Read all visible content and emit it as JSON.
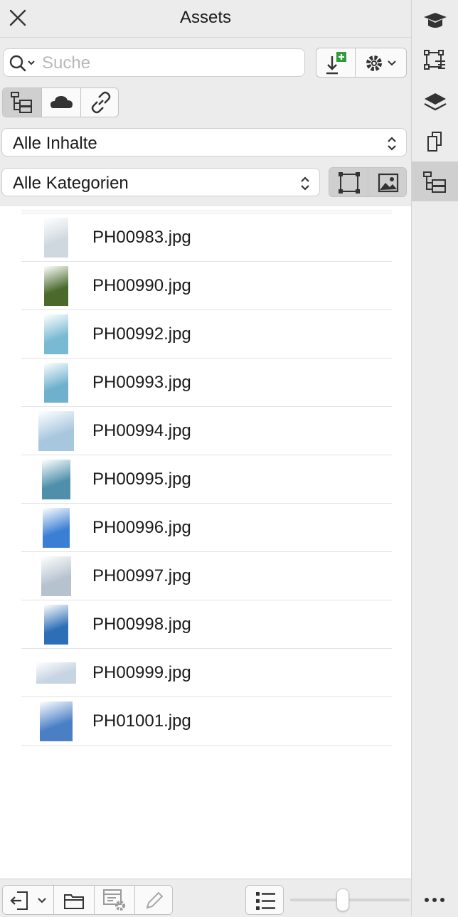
{
  "header": {
    "title": "Assets"
  },
  "search": {
    "placeholder": "Suche"
  },
  "filters": {
    "content_label": "Alle Inhalte",
    "category_label": "Alle Kategorien"
  },
  "files": [
    {
      "name": "PH00983.jpg",
      "thumb_color": "#cfd8df"
    },
    {
      "name": "PH00990.jpg",
      "thumb_color": "#4a6a2c"
    },
    {
      "name": "PH00992.jpg",
      "thumb_color": "#79b9d3"
    },
    {
      "name": "PH00993.jpg",
      "thumb_color": "#6fb1cc"
    },
    {
      "name": "PH00994.jpg",
      "thumb_color": "#a7c7de"
    },
    {
      "name": "PH00995.jpg",
      "thumb_color": "#4f8fab"
    },
    {
      "name": "PH00996.jpg",
      "thumb_color": "#3b7fd4"
    },
    {
      "name": "PH00997.jpg",
      "thumb_color": "#b7c2cf"
    },
    {
      "name": "PH00998.jpg",
      "thumb_color": "#2d6fb6"
    },
    {
      "name": "PH00999.jpg",
      "thumb_color": "#c7d4e2"
    },
    {
      "name": "PH01001.jpg",
      "thumb_color": "#4a7fc6"
    }
  ],
  "colors": {
    "accent_green": "#2e9c3a",
    "selected_gray": "#cfcfcf"
  },
  "zoom": {
    "slider_value": 0.43
  }
}
